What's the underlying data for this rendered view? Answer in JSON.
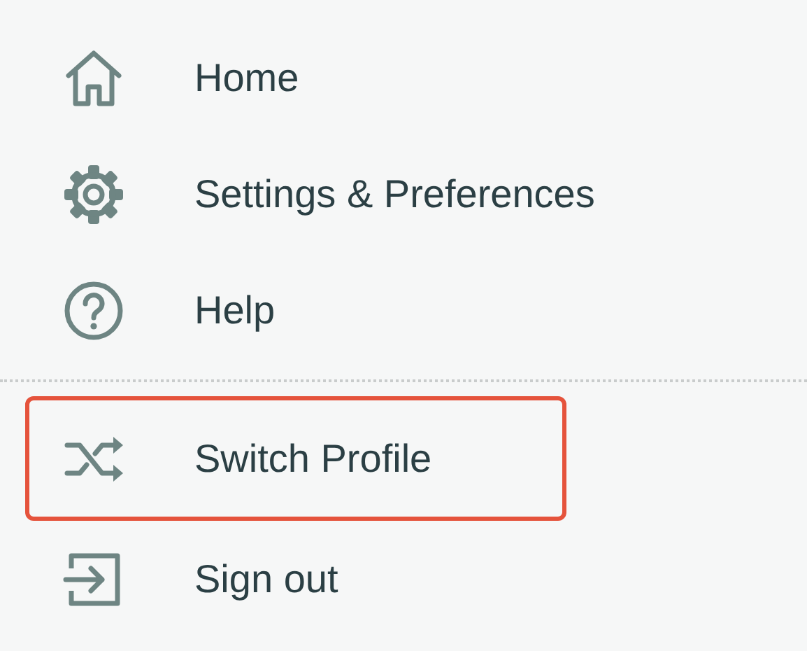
{
  "menu": {
    "groups": [
      {
        "items": [
          {
            "kind": "home",
            "label": "Home",
            "highlighted": false
          },
          {
            "kind": "gear",
            "label": "Settings & Preferences",
            "highlighted": false
          },
          {
            "kind": "help",
            "label": "Help",
            "highlighted": false
          }
        ]
      },
      {
        "items": [
          {
            "kind": "shuffle",
            "label": "Switch Profile",
            "highlighted": true
          },
          {
            "kind": "signout",
            "label": "Sign out",
            "highlighted": false
          }
        ]
      }
    ]
  }
}
